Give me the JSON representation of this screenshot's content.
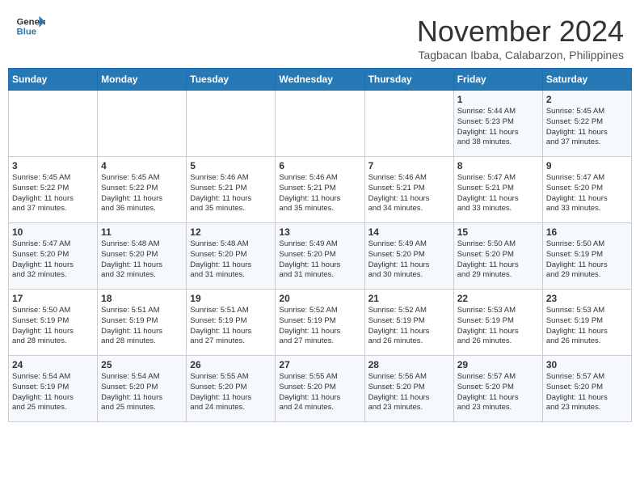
{
  "header": {
    "logo_line1": "General",
    "logo_line2": "Blue",
    "month": "November 2024",
    "location": "Tagbacan Ibaba, Calabarzon, Philippines"
  },
  "weekdays": [
    "Sunday",
    "Monday",
    "Tuesday",
    "Wednesday",
    "Thursday",
    "Friday",
    "Saturday"
  ],
  "weeks": [
    [
      {
        "day": "",
        "info": ""
      },
      {
        "day": "",
        "info": ""
      },
      {
        "day": "",
        "info": ""
      },
      {
        "day": "",
        "info": ""
      },
      {
        "day": "",
        "info": ""
      },
      {
        "day": "1",
        "info": "Sunrise: 5:44 AM\nSunset: 5:23 PM\nDaylight: 11 hours\nand 38 minutes."
      },
      {
        "day": "2",
        "info": "Sunrise: 5:45 AM\nSunset: 5:22 PM\nDaylight: 11 hours\nand 37 minutes."
      }
    ],
    [
      {
        "day": "3",
        "info": "Sunrise: 5:45 AM\nSunset: 5:22 PM\nDaylight: 11 hours\nand 37 minutes."
      },
      {
        "day": "4",
        "info": "Sunrise: 5:45 AM\nSunset: 5:22 PM\nDaylight: 11 hours\nand 36 minutes."
      },
      {
        "day": "5",
        "info": "Sunrise: 5:46 AM\nSunset: 5:21 PM\nDaylight: 11 hours\nand 35 minutes."
      },
      {
        "day": "6",
        "info": "Sunrise: 5:46 AM\nSunset: 5:21 PM\nDaylight: 11 hours\nand 35 minutes."
      },
      {
        "day": "7",
        "info": "Sunrise: 5:46 AM\nSunset: 5:21 PM\nDaylight: 11 hours\nand 34 minutes."
      },
      {
        "day": "8",
        "info": "Sunrise: 5:47 AM\nSunset: 5:21 PM\nDaylight: 11 hours\nand 33 minutes."
      },
      {
        "day": "9",
        "info": "Sunrise: 5:47 AM\nSunset: 5:20 PM\nDaylight: 11 hours\nand 33 minutes."
      }
    ],
    [
      {
        "day": "10",
        "info": "Sunrise: 5:47 AM\nSunset: 5:20 PM\nDaylight: 11 hours\nand 32 minutes."
      },
      {
        "day": "11",
        "info": "Sunrise: 5:48 AM\nSunset: 5:20 PM\nDaylight: 11 hours\nand 32 minutes."
      },
      {
        "day": "12",
        "info": "Sunrise: 5:48 AM\nSunset: 5:20 PM\nDaylight: 11 hours\nand 31 minutes."
      },
      {
        "day": "13",
        "info": "Sunrise: 5:49 AM\nSunset: 5:20 PM\nDaylight: 11 hours\nand 31 minutes."
      },
      {
        "day": "14",
        "info": "Sunrise: 5:49 AM\nSunset: 5:20 PM\nDaylight: 11 hours\nand 30 minutes."
      },
      {
        "day": "15",
        "info": "Sunrise: 5:50 AM\nSunset: 5:20 PM\nDaylight: 11 hours\nand 29 minutes."
      },
      {
        "day": "16",
        "info": "Sunrise: 5:50 AM\nSunset: 5:19 PM\nDaylight: 11 hours\nand 29 minutes."
      }
    ],
    [
      {
        "day": "17",
        "info": "Sunrise: 5:50 AM\nSunset: 5:19 PM\nDaylight: 11 hours\nand 28 minutes."
      },
      {
        "day": "18",
        "info": "Sunrise: 5:51 AM\nSunset: 5:19 PM\nDaylight: 11 hours\nand 28 minutes."
      },
      {
        "day": "19",
        "info": "Sunrise: 5:51 AM\nSunset: 5:19 PM\nDaylight: 11 hours\nand 27 minutes."
      },
      {
        "day": "20",
        "info": "Sunrise: 5:52 AM\nSunset: 5:19 PM\nDaylight: 11 hours\nand 27 minutes."
      },
      {
        "day": "21",
        "info": "Sunrise: 5:52 AM\nSunset: 5:19 PM\nDaylight: 11 hours\nand 26 minutes."
      },
      {
        "day": "22",
        "info": "Sunrise: 5:53 AM\nSunset: 5:19 PM\nDaylight: 11 hours\nand 26 minutes."
      },
      {
        "day": "23",
        "info": "Sunrise: 5:53 AM\nSunset: 5:19 PM\nDaylight: 11 hours\nand 26 minutes."
      }
    ],
    [
      {
        "day": "24",
        "info": "Sunrise: 5:54 AM\nSunset: 5:19 PM\nDaylight: 11 hours\nand 25 minutes."
      },
      {
        "day": "25",
        "info": "Sunrise: 5:54 AM\nSunset: 5:20 PM\nDaylight: 11 hours\nand 25 minutes."
      },
      {
        "day": "26",
        "info": "Sunrise: 5:55 AM\nSunset: 5:20 PM\nDaylight: 11 hours\nand 24 minutes."
      },
      {
        "day": "27",
        "info": "Sunrise: 5:55 AM\nSunset: 5:20 PM\nDaylight: 11 hours\nand 24 minutes."
      },
      {
        "day": "28",
        "info": "Sunrise: 5:56 AM\nSunset: 5:20 PM\nDaylight: 11 hours\nand 23 minutes."
      },
      {
        "day": "29",
        "info": "Sunrise: 5:57 AM\nSunset: 5:20 PM\nDaylight: 11 hours\nand 23 minutes."
      },
      {
        "day": "30",
        "info": "Sunrise: 5:57 AM\nSunset: 5:20 PM\nDaylight: 11 hours\nand 23 minutes."
      }
    ]
  ]
}
